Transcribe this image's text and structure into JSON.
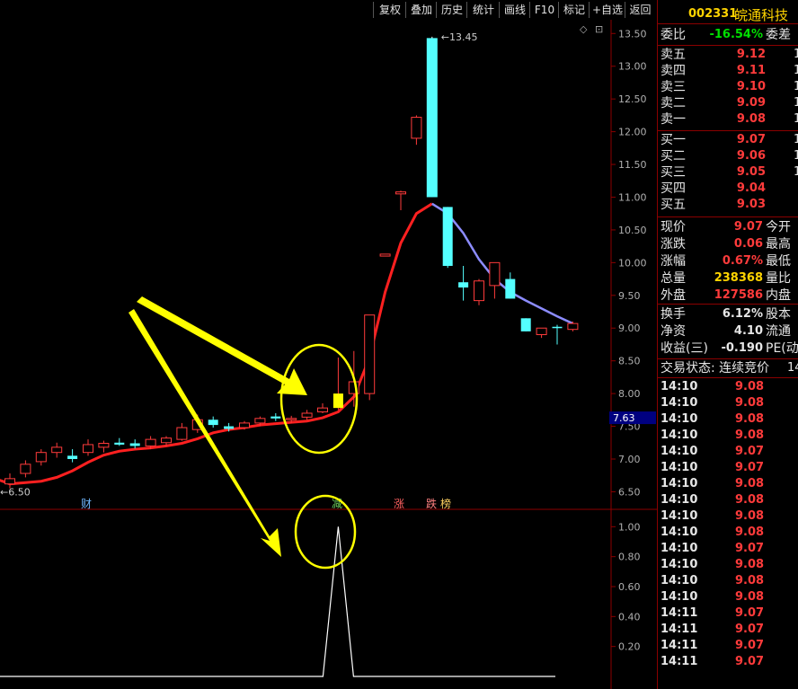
{
  "toolbar": {
    "buttons": [
      "复权",
      "叠加",
      "历史",
      "统计",
      "画线",
      "F10",
      "标记",
      "+自选",
      "返回"
    ]
  },
  "stock": {
    "code": "002331",
    "name": "皖通科技"
  },
  "quote": {
    "webi": {
      "label": "委比",
      "value": "-16.54%",
      "label2": "委差"
    },
    "asks": [
      {
        "label": "卖五",
        "price": "9.12"
      },
      {
        "label": "卖四",
        "price": "9.11"
      },
      {
        "label": "卖三",
        "price": "9.10"
      },
      {
        "label": "卖二",
        "price": "9.09"
      },
      {
        "label": "卖一",
        "price": "9.08"
      }
    ],
    "bids": [
      {
        "label": "买一",
        "price": "9.07"
      },
      {
        "label": "买二",
        "price": "9.06"
      },
      {
        "label": "买三",
        "price": "9.05"
      },
      {
        "label": "买四",
        "price": "9.04"
      },
      {
        "label": "买五",
        "price": "9.03"
      }
    ],
    "stats1": [
      {
        "label": "现价",
        "value": "9.07",
        "label2": "今开",
        "color": "red"
      },
      {
        "label": "涨跌",
        "value": "0.06",
        "label2": "最高",
        "color": "red"
      },
      {
        "label": "涨幅",
        "value": "0.67%",
        "label2": "最低",
        "color": "red"
      },
      {
        "label": "总量",
        "value": "238368",
        "label2": "量比",
        "color": "yellow"
      },
      {
        "label": "外盘",
        "value": "127586",
        "label2": "内盘",
        "color": "red"
      }
    ],
    "stats2": [
      {
        "label": "换手",
        "value": "6.12%",
        "label2": "股本"
      },
      {
        "label": "净资",
        "value": "4.10",
        "label2": "流通"
      },
      {
        "label": "收益(三)",
        "value": "-0.190",
        "label2": "PE(动"
      }
    ],
    "trade_status": "交易状态: 连续竞价",
    "trade_status_cut": "14",
    "ticks": [
      {
        "time": "14:10",
        "price": "9.08"
      },
      {
        "time": "14:10",
        "price": "9.08"
      },
      {
        "time": "14:10",
        "price": "9.08"
      },
      {
        "time": "14:10",
        "price": "9.08"
      },
      {
        "time": "14:10",
        "price": "9.07"
      },
      {
        "time": "14:10",
        "price": "9.07"
      },
      {
        "time": "14:10",
        "price": "9.08"
      },
      {
        "time": "14:10",
        "price": "9.08"
      },
      {
        "time": "14:10",
        "price": "9.08"
      },
      {
        "time": "14:10",
        "price": "9.08"
      },
      {
        "time": "14:10",
        "price": "9.07"
      },
      {
        "time": "14:10",
        "price": "9.08"
      },
      {
        "time": "14:10",
        "price": "9.08"
      },
      {
        "time": "14:10",
        "price": "9.08"
      },
      {
        "time": "14:11",
        "price": "9.07"
      },
      {
        "time": "14:11",
        "price": "9.07"
      },
      {
        "time": "14:11",
        "price": "9.07"
      },
      {
        "time": "14:11",
        "price": "9.07"
      }
    ]
  },
  "chart_data": {
    "type": "candlestick",
    "price_axis": {
      "ticks": [
        "13.50",
        "13.00",
        "12.50",
        "12.00",
        "11.50",
        "11.00",
        "10.50",
        "10.00",
        "9.50",
        "9.00",
        "8.50",
        "8.00",
        "7.50",
        "7.00",
        "6.50"
      ],
      "range": [
        6.3,
        13.6
      ]
    },
    "current_price_label": "7.63",
    "high_label": "13.45",
    "low_label": "6.50",
    "event_markers": [
      "财",
      "减",
      "涨",
      "跌",
      "榜"
    ],
    "indicator_axis": {
      "ticks": [
        "1.00",
        "0.80",
        "0.60",
        "0.40",
        "0.20"
      ],
      "range": [
        0,
        1.05
      ]
    },
    "candles": [
      {
        "o": 6.62,
        "h": 6.78,
        "l": 6.55,
        "c": 6.7,
        "up": true
      },
      {
        "o": 6.78,
        "h": 6.98,
        "l": 6.72,
        "c": 6.92,
        "up": true
      },
      {
        "o": 6.96,
        "h": 7.15,
        "l": 6.9,
        "c": 7.1,
        "up": true
      },
      {
        "o": 7.1,
        "h": 7.25,
        "l": 7.02,
        "c": 7.18,
        "up": true
      },
      {
        "o": 7.05,
        "h": 7.15,
        "l": 6.95,
        "c": 7.0,
        "up": false
      },
      {
        "o": 7.1,
        "h": 7.3,
        "l": 7.05,
        "c": 7.22,
        "up": true
      },
      {
        "o": 7.18,
        "h": 7.28,
        "l": 7.1,
        "c": 7.24,
        "up": true
      },
      {
        "o": 7.25,
        "h": 7.32,
        "l": 7.2,
        "c": 7.22,
        "up": false
      },
      {
        "o": 7.24,
        "h": 7.3,
        "l": 7.16,
        "c": 7.2,
        "up": false
      },
      {
        "o": 7.2,
        "h": 7.35,
        "l": 7.15,
        "c": 7.3,
        "up": true
      },
      {
        "o": 7.25,
        "h": 7.35,
        "l": 7.2,
        "c": 7.32,
        "up": true
      },
      {
        "o": 7.3,
        "h": 7.55,
        "l": 7.28,
        "c": 7.48,
        "up": true
      },
      {
        "o": 7.45,
        "h": 7.68,
        "l": 7.4,
        "c": 7.6,
        "up": true
      },
      {
        "o": 7.6,
        "h": 7.65,
        "l": 7.48,
        "c": 7.52,
        "up": false
      },
      {
        "o": 7.5,
        "h": 7.55,
        "l": 7.42,
        "c": 7.46,
        "up": false
      },
      {
        "o": 7.48,
        "h": 7.58,
        "l": 7.45,
        "c": 7.55,
        "up": true
      },
      {
        "o": 7.55,
        "h": 7.65,
        "l": 7.5,
        "c": 7.62,
        "up": true
      },
      {
        "o": 7.65,
        "h": 7.7,
        "l": 7.58,
        "c": 7.62,
        "up": false
      },
      {
        "o": 7.6,
        "h": 7.66,
        "l": 7.55,
        "c": 7.62,
        "up": true
      },
      {
        "o": 7.64,
        "h": 7.75,
        "l": 7.6,
        "c": 7.7,
        "up": true
      },
      {
        "o": 7.72,
        "h": 7.85,
        "l": 7.7,
        "c": 7.78,
        "up": true
      },
      {
        "o": 7.78,
        "h": 8.55,
        "l": 7.75,
        "c": 8.0,
        "up": true,
        "highlight": true
      },
      {
        "o": 8.0,
        "h": 8.65,
        "l": 7.8,
        "c": 8.18,
        "up": true
      },
      {
        "o": 8.0,
        "h": 9.2,
        "l": 7.9,
        "c": 9.2,
        "up": true
      },
      {
        "o": 10.13,
        "h": 10.13,
        "l": 10.1,
        "c": 10.1,
        "up": true
      },
      {
        "o": 11.08,
        "h": 11.1,
        "l": 10.8,
        "c": 11.05,
        "up": true
      },
      {
        "o": 11.9,
        "h": 12.25,
        "l": 11.8,
        "c": 12.22,
        "up": true
      },
      {
        "o": 13.43,
        "h": 13.45,
        "l": 11.0,
        "c": 11.0,
        "up": false
      },
      {
        "o": 10.85,
        "h": 10.85,
        "l": 9.92,
        "c": 9.95,
        "up": false
      },
      {
        "o": 9.7,
        "h": 9.95,
        "l": 9.42,
        "c": 9.62,
        "up": false
      },
      {
        "o": 9.42,
        "h": 9.75,
        "l": 9.35,
        "c": 9.72,
        "up": true
      },
      {
        "o": 9.65,
        "h": 10.0,
        "l": 9.45,
        "c": 10.0,
        "up": true
      },
      {
        "o": 9.75,
        "h": 9.85,
        "l": 9.45,
        "c": 9.45,
        "up": false
      },
      {
        "o": 9.15,
        "h": 9.15,
        "l": 8.95,
        "c": 8.95,
        "up": false
      },
      {
        "o": 8.9,
        "h": 9.0,
        "l": 8.85,
        "c": 9.0,
        "up": true
      },
      {
        "o": 9.02,
        "h": 9.05,
        "l": 8.75,
        "c": 9.0,
        "up": false
      },
      {
        "o": 8.98,
        "h": 9.1,
        "l": 8.95,
        "c": 9.07,
        "up": true
      }
    ],
    "ma": [
      6.62,
      6.64,
      6.66,
      6.72,
      6.82,
      6.95,
      7.06,
      7.12,
      7.15,
      7.17,
      7.2,
      7.24,
      7.31,
      7.4,
      7.45,
      7.48,
      7.52,
      7.54,
      7.56,
      7.58,
      7.63,
      7.72,
      7.95,
      8.55,
      9.55,
      10.3,
      10.75,
      10.9,
      10.75,
      10.45,
      10.05,
      9.75,
      9.55,
      9.42,
      9.3,
      9.18,
      9.07
    ],
    "indicator": [
      0,
      0,
      0,
      0,
      0,
      0,
      0,
      0,
      0,
      0,
      0,
      0,
      0,
      0,
      0,
      0,
      0,
      0,
      0,
      0,
      0,
      1,
      0,
      0,
      0,
      0,
      0,
      0,
      0,
      0,
      0,
      0,
      0,
      0,
      0,
      0,
      0
    ]
  },
  "colors": {
    "up": "#ff3b3b",
    "down": "#54ffff",
    "ma_up": "#ff2020",
    "ma_down": "#8c8cff",
    "arrow": "#ffff00",
    "axis": "#8b0000"
  }
}
